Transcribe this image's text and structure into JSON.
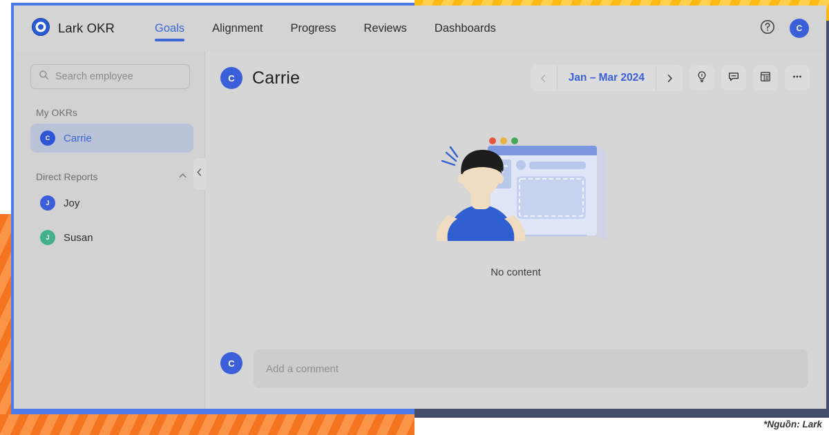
{
  "brand": {
    "name": "Lark OKR",
    "logo_icon": "bullseye-icon",
    "logo_color": "#2a5bd7"
  },
  "nav": {
    "tabs": [
      {
        "label": "Goals",
        "active": true
      },
      {
        "label": "Alignment",
        "active": false
      },
      {
        "label": "Progress",
        "active": false
      },
      {
        "label": "Reviews",
        "active": false
      },
      {
        "label": "Dashboards",
        "active": false
      }
    ],
    "active_color": "#3a66d8",
    "help_icon": "question-circle-icon",
    "avatar": {
      "initial": "C",
      "color": "#3a5fd9"
    }
  },
  "sidebar": {
    "search": {
      "placeholder": "Search employee",
      "icon": "search-icon",
      "value": ""
    },
    "my_okrs_label": "My OKRs",
    "my_okrs": [
      {
        "name": "Carrie",
        "initial": "C",
        "color": "#2f55d4",
        "selected": true
      }
    ],
    "direct_reports_label": "Direct Reports",
    "direct_reports_collapse_icon": "chevron-up-icon",
    "direct_reports": [
      {
        "name": "Joy",
        "initial": "J",
        "color": "#3a5fd9",
        "selected": false
      },
      {
        "name": "Susan",
        "initial": "J",
        "color": "#44b08c",
        "selected": false
      }
    ],
    "collapse_icon": "chevron-left-icon"
  },
  "main": {
    "page_title": "Carrie",
    "page_avatar": {
      "initial": "C",
      "color": "#3a5fd9"
    },
    "date_range": {
      "prev_icon": "chevron-left-icon",
      "label": "Jan – Mar 2024",
      "next_icon": "chevron-right-icon",
      "label_color": "#3a5fd9"
    },
    "tools": [
      {
        "icon": "lightbulb-icon",
        "name": "tips-button"
      },
      {
        "icon": "comment-icon",
        "name": "comments-button"
      },
      {
        "icon": "list-view-icon",
        "name": "list-view-button"
      },
      {
        "icon": "more-dots-icon",
        "name": "more-button"
      }
    ],
    "empty_state": {
      "illustration": "person-at-browser-illustration",
      "text": "No content"
    },
    "comment": {
      "avatar": {
        "initial": "C",
        "color": "#3a5fd9"
      },
      "placeholder": "Add a comment",
      "value": ""
    }
  },
  "footer": {
    "caption": "*Nguồn: Lark"
  },
  "decor": {
    "stripes_amber": "#fdb913",
    "stripes_orange": "#f4741f",
    "frame_blue": "#4a7ae8",
    "frame_dark": "#454f6b"
  }
}
